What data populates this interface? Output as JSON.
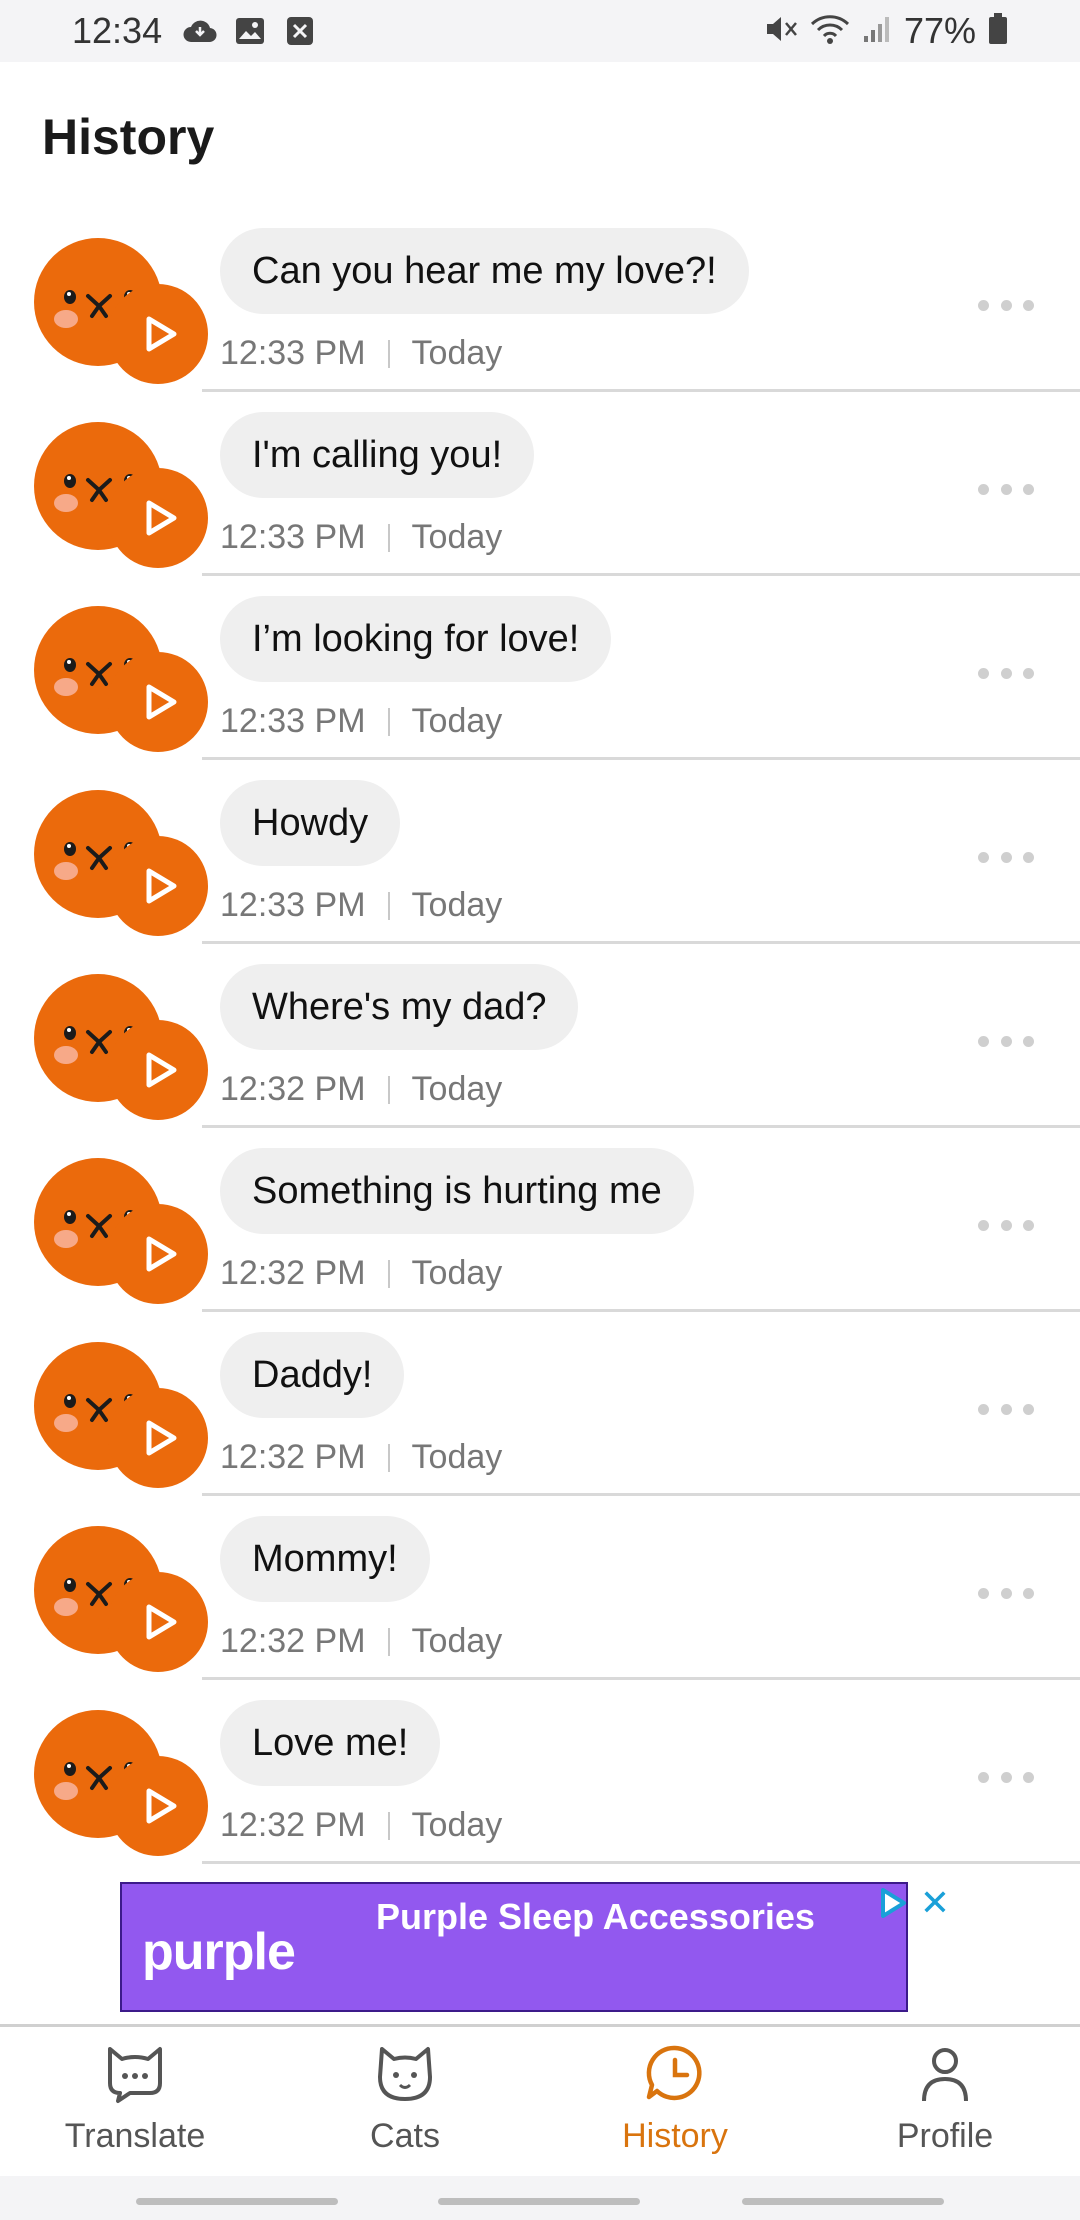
{
  "status_bar": {
    "time": "12:34",
    "battery": "77%",
    "left_icons": [
      "cloud-icon",
      "image-icon",
      "x-box-icon"
    ],
    "right_icons": [
      "mute-icon",
      "wifi-icon",
      "signal-icon",
      "battery-icon"
    ]
  },
  "header": {
    "title": "History"
  },
  "history": [
    {
      "text": "Can you hear me my love?!",
      "time": "12:33 PM",
      "day": "Today"
    },
    {
      "text": "I'm calling you!",
      "time": "12:33 PM",
      "day": "Today"
    },
    {
      "text": "I’m looking for love!",
      "time": "12:33 PM",
      "day": "Today"
    },
    {
      "text": "Howdy",
      "time": "12:33 PM",
      "day": "Today"
    },
    {
      "text": "Where's my dad?",
      "time": "12:32 PM",
      "day": "Today"
    },
    {
      "text": "Something is hurting me",
      "time": "12:32 PM",
      "day": "Today"
    },
    {
      "text": "Daddy!",
      "time": "12:32 PM",
      "day": "Today"
    },
    {
      "text": "Mommy!",
      "time": "12:32 PM",
      "day": "Today"
    },
    {
      "text": "Love me!",
      "time": "12:32 PM",
      "day": "Today"
    }
  ],
  "ad": {
    "logo": "purple",
    "title": "Purple Sleep Accessories",
    "close": "✕"
  },
  "nav": {
    "items": [
      {
        "label": "Translate",
        "icon": "cat-chat-icon",
        "active": false
      },
      {
        "label": "Cats",
        "icon": "cat-face-icon",
        "active": false
      },
      {
        "label": "History",
        "icon": "clock-chat-icon",
        "active": true
      },
      {
        "label": "Profile",
        "icon": "person-icon",
        "active": false
      }
    ]
  },
  "colors": {
    "accent": "#eb6a0c",
    "active_nav": "#d9740e",
    "ad_background": "#9258ef"
  }
}
